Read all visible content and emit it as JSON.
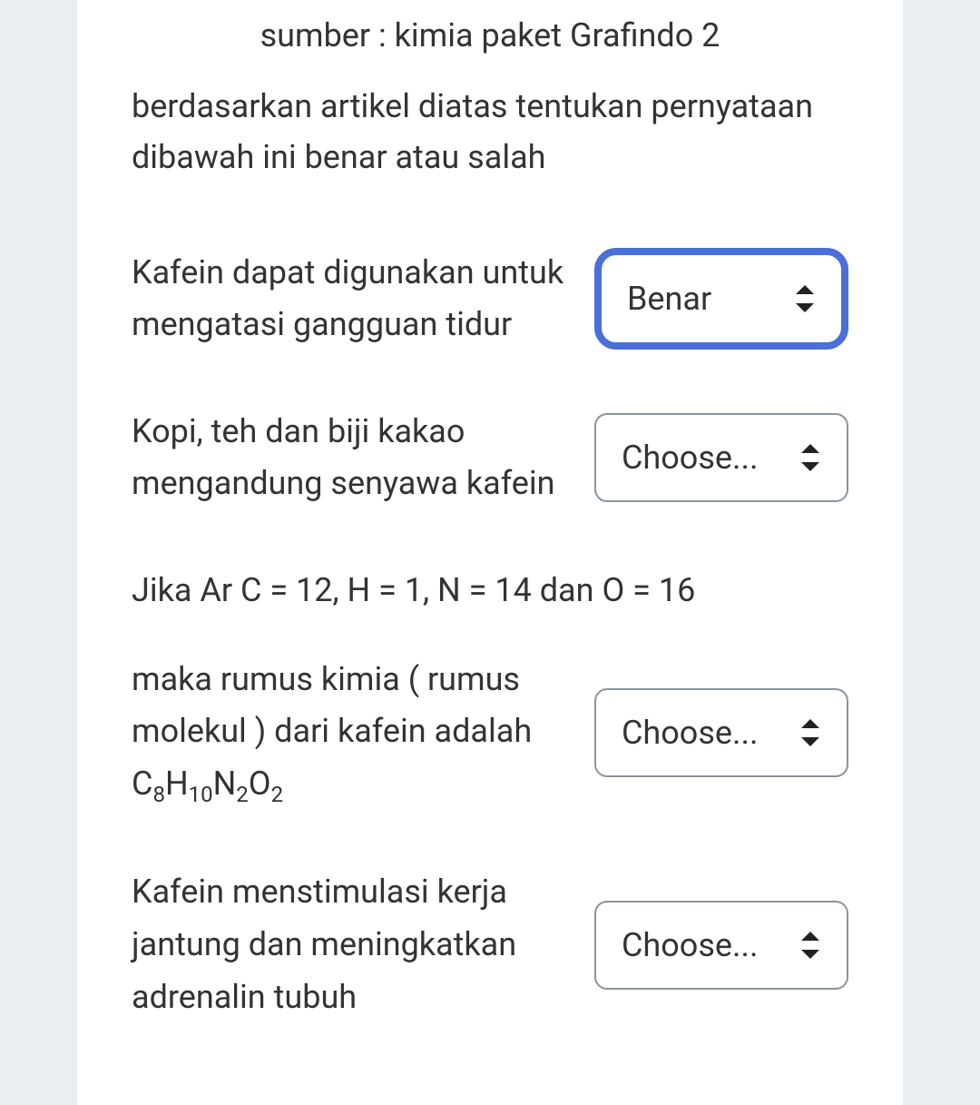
{
  "source_line": "sumber : kimia paket Grafindo 2",
  "instruction": "berdasarkan artikel diatas tentukan pernyataan dibawah ini benar atau salah",
  "placeholder_choose": "Choose...",
  "option_benar": "Benar",
  "questions": {
    "q1": {
      "text": "Kafein dapat digunakan untuk mengatasi gangguan tidur",
      "selected": "Benar"
    },
    "q2": {
      "text": "Kopi, teh dan biji kakao mengandung senyawa kafein",
      "selected": "Choose..."
    },
    "q3": {
      "line1": "Jika Ar C = 12, H = 1, N = 14 dan O = 16",
      "line2_pre": "maka rumus kimia ( rumus molekul ) dari kafein adalah C",
      "sub1": "8",
      "h": "H",
      "sub2": "10",
      "n": "N",
      "sub3": "2",
      "o": "O",
      "sub4": "2",
      "selected": "Choose..."
    },
    "q4": {
      "text": "Kafein menstimulasi kerja jantung dan meningkatkan adrenalin tubuh",
      "selected": "Choose..."
    }
  }
}
